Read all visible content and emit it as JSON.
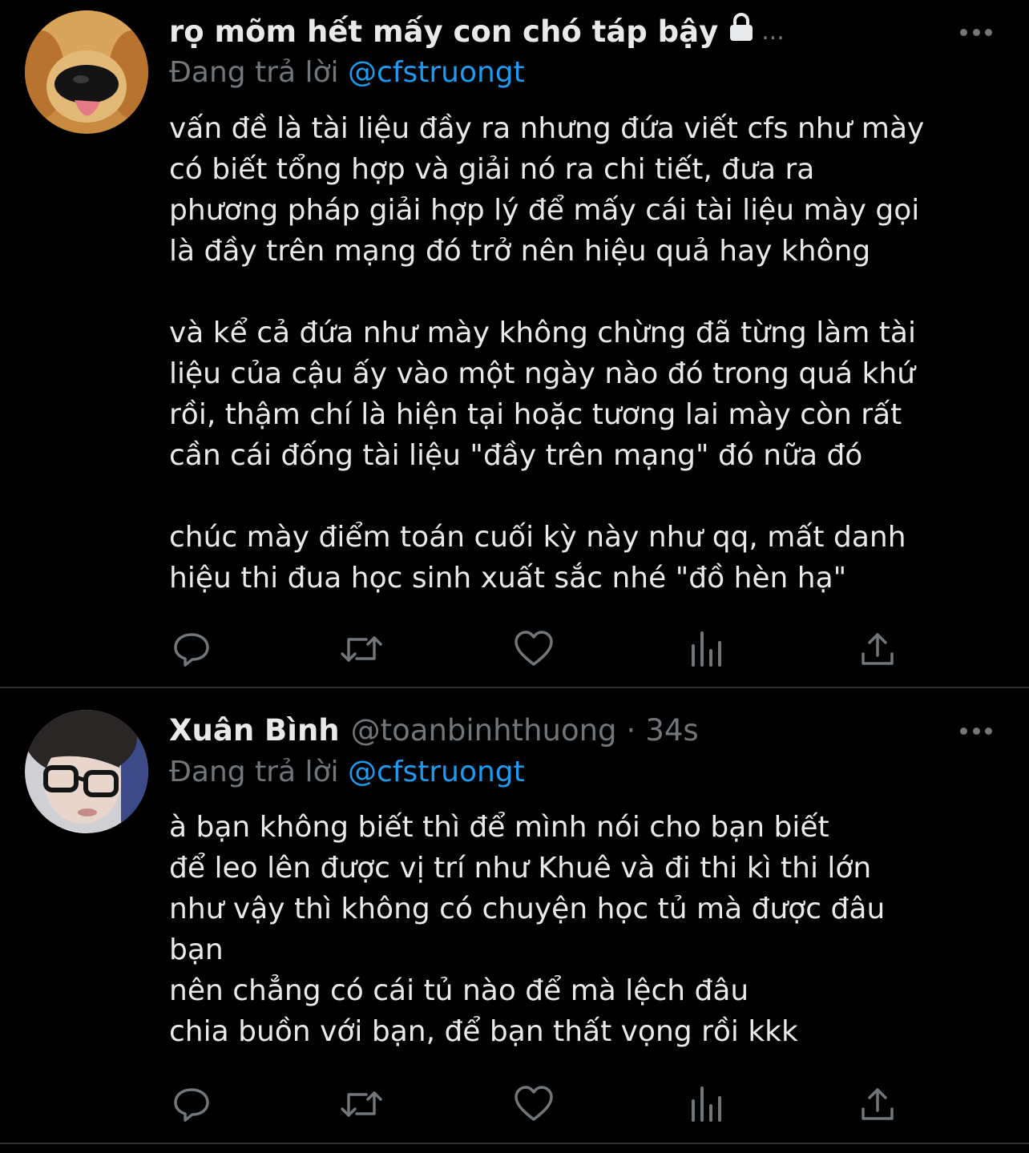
{
  "tweets": [
    {
      "display_name": "rọ mõm hết mấy con chó táp bậy",
      "handle": "",
      "time": "",
      "truncation": "...",
      "replying_label": "Đang trả lời",
      "replying_to": "@cfstruongt",
      "text": "vấn đề là tài liệu đầy ra nhưng đứa viết cfs như mày\ncó biết tổng hợp và giải nó ra chi tiết, đưa ra\nphương pháp giải hợp lý để mấy cái tài liệu mày gọi\nlà đầy trên mạng đó trở nên hiệu quả hay không\n\nvà kể cả đứa như mày không chừng đã từng làm tài\nliệu của cậu ấy vào một ngày nào đó trong quá khứ\nrồi, thậm chí là hiện tại hoặc tương lai mày còn rất\ncần cái đống tài liệu \"đầy trên mạng\" đó nữa đó\n\nchúc mày điểm toán cuối kỳ này như qq, mất danh\nhiệu thi đua học sinh xuất sắc nhé \"đồ hèn hạ\"",
      "locked": true,
      "avatar": "golden-retriever-avatar"
    },
    {
      "display_name": "Xuân Bình",
      "handle": "@toanbinhthuong",
      "separator": "·",
      "time": "34s",
      "replying_label": "Đang trả lời",
      "replying_to": "@cfstruongt",
      "text": "à bạn không biết thì để mình nói cho bạn biết\nđể leo lên được vị trí như Khuê và đi thi kì thi lớn\nnhư vậy thì không có chuyện học tủ mà được đâu\nbạn\nnên chẳng có cái tủ nào để mà lệch đâu\nchia buồn với bạn, để bạn thất vọng rồi kkk",
      "locked": false,
      "avatar": "person-glasses-avatar"
    }
  ],
  "actions": [
    "reply-icon",
    "retweet-icon",
    "like-icon",
    "analytics-icon",
    "share-icon"
  ],
  "colors": {
    "background": "#000000",
    "text": "#e7e9ea",
    "secondary": "#71767b",
    "accent": "#1d9bf0",
    "divider": "#2f3336"
  }
}
